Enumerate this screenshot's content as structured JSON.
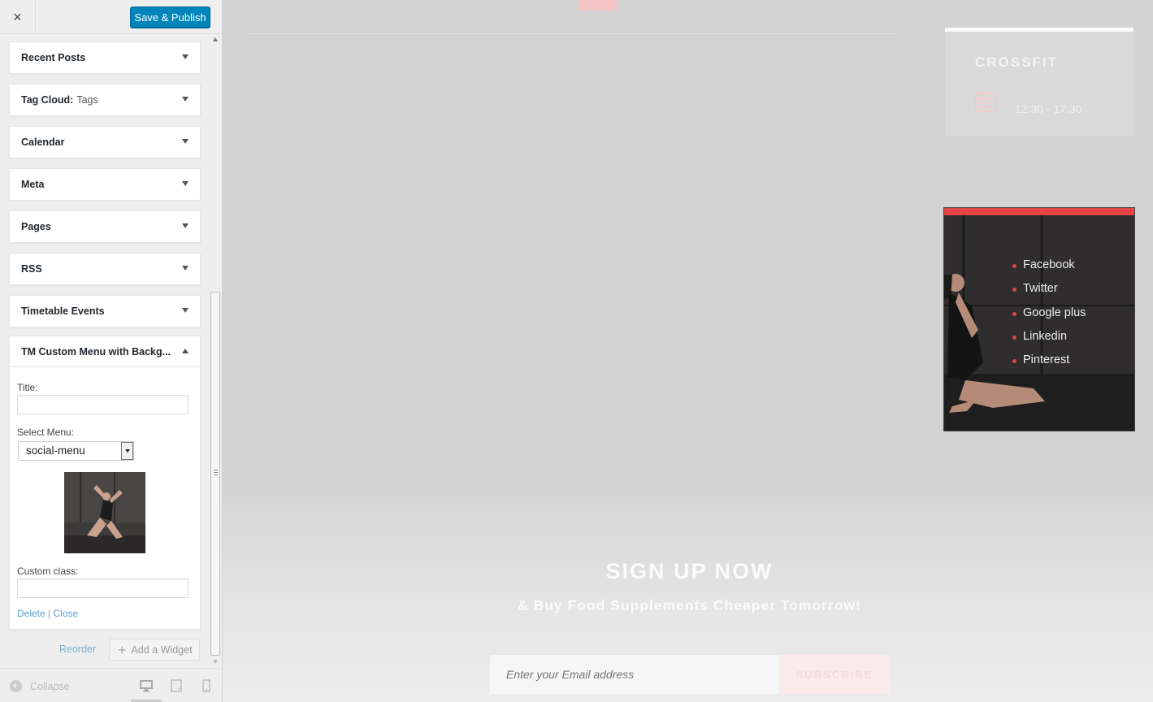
{
  "header": {
    "close_icon": "×",
    "publish_label": "Save & Publish"
  },
  "widgets": [
    {
      "title": "Recent Posts",
      "subtitle": ""
    },
    {
      "title": "Tag Cloud:",
      "subtitle": "Tags"
    },
    {
      "title": "Calendar",
      "subtitle": ""
    },
    {
      "title": "Meta",
      "subtitle": ""
    },
    {
      "title": "Pages",
      "subtitle": ""
    },
    {
      "title": "RSS",
      "subtitle": ""
    },
    {
      "title": "Timetable Events",
      "subtitle": ""
    }
  ],
  "open_widget": {
    "title": "TM Custom Menu with Backg...",
    "title_label": "Title:",
    "title_value": "",
    "select_menu_label": "Select Menu:",
    "select_menu_value": "social-menu",
    "custom_class_label": "Custom class:",
    "custom_class_value": "",
    "delete_label": "Delete",
    "separator": "|",
    "close_label": "Close"
  },
  "actions": {
    "reorder_label": "Reorder",
    "add_widget_label": "Add a Widget"
  },
  "footer": {
    "collapse_label": "Collapse"
  },
  "preview": {
    "event": {
      "title": "CROSSFIT",
      "time": "12:30 - 17:30"
    },
    "social_menu": [
      "Facebook",
      "Twitter",
      "Google plus",
      "Linkedin",
      "Pinterest"
    ],
    "signup_title": "SIGN UP NOW",
    "signup_subtitle": "& Buy Food Supplements Cheaper Tomorrow!",
    "email_placeholder": "Enter your Email address",
    "subscribe_label": "SUBSCRIBE"
  },
  "colors": {
    "publish": "#0085ba",
    "accent_red": "#e24545",
    "link": "#5aa3d6"
  }
}
